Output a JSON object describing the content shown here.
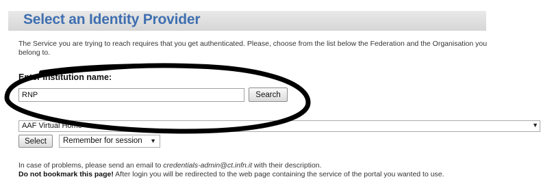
{
  "header": {
    "title": "Select an Identity Provider"
  },
  "intro": {
    "text": "The Service you are trying to reach requires that you get authenticated. Please, choose from the list below the Federation and the Organisation you belong to."
  },
  "search": {
    "label": "Enter institution name:",
    "value": "RNP",
    "button_label": "Search"
  },
  "idp_list": {
    "selected": "AAF Virtual Home"
  },
  "actions": {
    "select_label": "Select",
    "remember_value": "Remember for session"
  },
  "footer": {
    "line1_prefix": "In case of problems, please send an email to ",
    "email": "credentials-admin@ct.infn.it",
    "line1_suffix": " with their description.",
    "bold_warning": "Do not bookmark this page!",
    "line2_rest": " After login you will be redirected to the web page containing the service of the portal you wanted to use."
  },
  "annotation": {
    "color": "#000000"
  }
}
